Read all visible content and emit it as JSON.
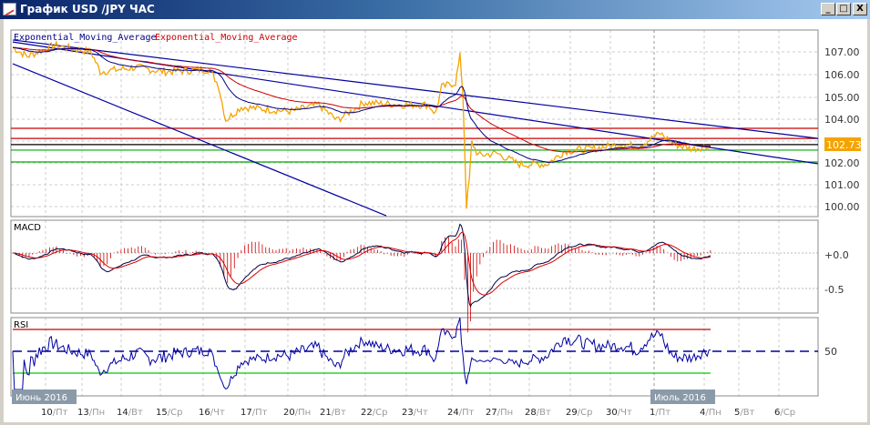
{
  "window": {
    "title": "График USD /JPY ЧАС",
    "minimize": "_",
    "maximize": "□",
    "close": "X"
  },
  "legend": {
    "ema1": "Exponential_Moving_Average",
    "ema2": "Exponential_Moving_Average"
  },
  "colors": {
    "price": "#f5a300",
    "ema_fast": "#000080",
    "ema_slow": "#cc0000",
    "trend": "#0000a0",
    "badge": "#f5a300"
  },
  "price_axis": {
    "labels": [
      "107.00",
      "106.00",
      "105.00",
      "104.00",
      "102.00",
      "101.00",
      "100.00"
    ],
    "current": "102.73"
  },
  "macd": {
    "title": "MACD",
    "labels": [
      "+0.0",
      "-0.5"
    ]
  },
  "rsi": {
    "title": "RSI",
    "labels": [
      "50"
    ]
  },
  "dates": {
    "month_left": "Июнь 2016",
    "month_right": "Июль 2016",
    "days": [
      [
        "10",
        "Пт"
      ],
      [
        "13",
        "Пн"
      ],
      [
        "14",
        "Вт"
      ],
      [
        "15",
        "Ср"
      ],
      [
        "16",
        "Чт"
      ],
      [
        "17",
        "Пт"
      ],
      [
        "20",
        "Пн"
      ],
      [
        "21",
        "Вт"
      ],
      [
        "22",
        "Ср"
      ],
      [
        "23",
        "Чт"
      ],
      [
        "24",
        "Пт"
      ],
      [
        "27",
        "Пн"
      ],
      [
        "28",
        "Вт"
      ],
      [
        "29",
        "Ср"
      ],
      [
        "30",
        "Чт"
      ],
      [
        "1",
        "Пт"
      ],
      [
        "4",
        "Пн"
      ],
      [
        "5",
        "Вт"
      ],
      [
        "6",
        "Ср"
      ]
    ]
  },
  "chart_data": {
    "type": "line",
    "title": "USD/JPY H1",
    "x_unit": "trading day index (0 = 10 June 2016)",
    "xlim": [
      -0.96,
      18.81
    ],
    "ylim": [
      99.3,
      108.2
    ],
    "price": [
      [
        -0.96,
        107.2
      ],
      [
        -0.6,
        106.8
      ],
      [
        0.07,
        107.3
      ],
      [
        0.96,
        107.0
      ],
      [
        1.19,
        106.1
      ],
      [
        2.08,
        106.3
      ],
      [
        2.75,
        106.1
      ],
      [
        3.87,
        106.2
      ],
      [
        4.09,
        105.5
      ],
      [
        4.27,
        103.9
      ],
      [
        4.65,
        104.5
      ],
      [
        5.21,
        104.4
      ],
      [
        5.88,
        104.3
      ],
      [
        6.55,
        104.6
      ],
      [
        7.0,
        103.9
      ],
      [
        7.67,
        104.7
      ],
      [
        8.57,
        104.6
      ],
      [
        9.24,
        104.6
      ],
      [
        9.42,
        104.2
      ],
      [
        9.57,
        105.4
      ],
      [
        9.91,
        105.6
      ],
      [
        10.02,
        106.8
      ],
      [
        10.09,
        105.2
      ],
      [
        10.18,
        100.0
      ],
      [
        10.25,
        101.2
      ],
      [
        10.31,
        102.9
      ],
      [
        10.47,
        102.3
      ],
      [
        10.92,
        102.4
      ],
      [
        11.48,
        101.9
      ],
      [
        12.15,
        101.9
      ],
      [
        12.6,
        102.5
      ],
      [
        13.27,
        102.6
      ],
      [
        13.94,
        102.8
      ],
      [
        14.38,
        102.7
      ],
      [
        14.94,
        103.3
      ],
      [
        15.28,
        102.8
      ],
      [
        15.73,
        102.6
      ],
      [
        16.17,
        102.75
      ]
    ],
    "trendlines": [
      [
        [
          -0.96,
          107.54
        ],
        [
          18.81,
          103.07
        ]
      ],
      [
        [
          -0.96,
          107.45
        ],
        [
          18.81,
          101.92
        ]
      ],
      [
        [
          -0.96,
          106.46
        ],
        [
          8.21,
          99.56
        ]
      ]
    ],
    "hlines": [
      {
        "price": 103.53,
        "color": "#cc0000"
      },
      {
        "price": 103.07,
        "color": "#cc0000"
      },
      {
        "price": 102.79,
        "color": "#000000"
      },
      {
        "price": 102.54,
        "color": "#00aa00"
      },
      {
        "price": 102.0,
        "color": "#00aa00"
      }
    ],
    "rsi_levels": [
      70,
      30,
      50
    ],
    "macd_range": [
      -0.75,
      0.4
    ]
  }
}
